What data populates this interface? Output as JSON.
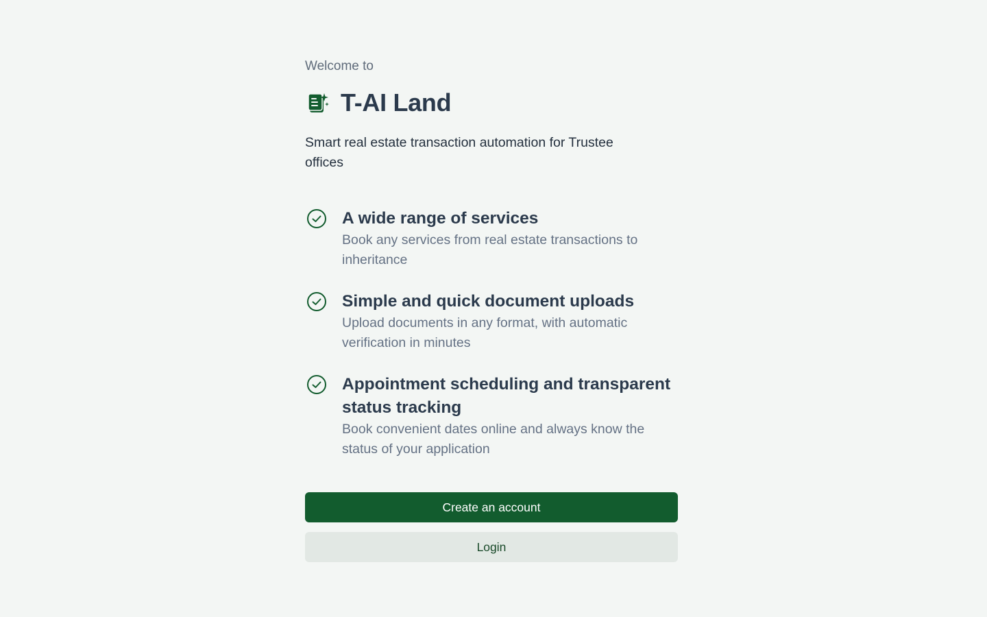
{
  "welcome": {
    "prefix": "Welcome to",
    "brand_name": "T-AI Land",
    "brand_icon": "ai-document-icon",
    "tagline": "Smart real estate transaction automation for Trustee offices"
  },
  "features": [
    {
      "icon": "check-circle-icon",
      "title": "A wide range of services",
      "description": "Book any services from real estate transactions to inheritance"
    },
    {
      "icon": "check-circle-icon",
      "title": "Simple and quick document uploads",
      "description": "Upload documents in any format, with automatic verification in minutes"
    },
    {
      "icon": "check-circle-icon",
      "title": "Appointment scheduling and transparent status tracking",
      "description": "Book convenient dates online and always know the status of your application"
    }
  ],
  "actions": {
    "create_account_label": "Create an account",
    "login_label": "Login"
  },
  "colors": {
    "background": "#f3f6f4",
    "primary": "#125c2e",
    "secondary_button": "#e2e8e4",
    "heading": "#2b3a4c",
    "muted": "#647184"
  }
}
